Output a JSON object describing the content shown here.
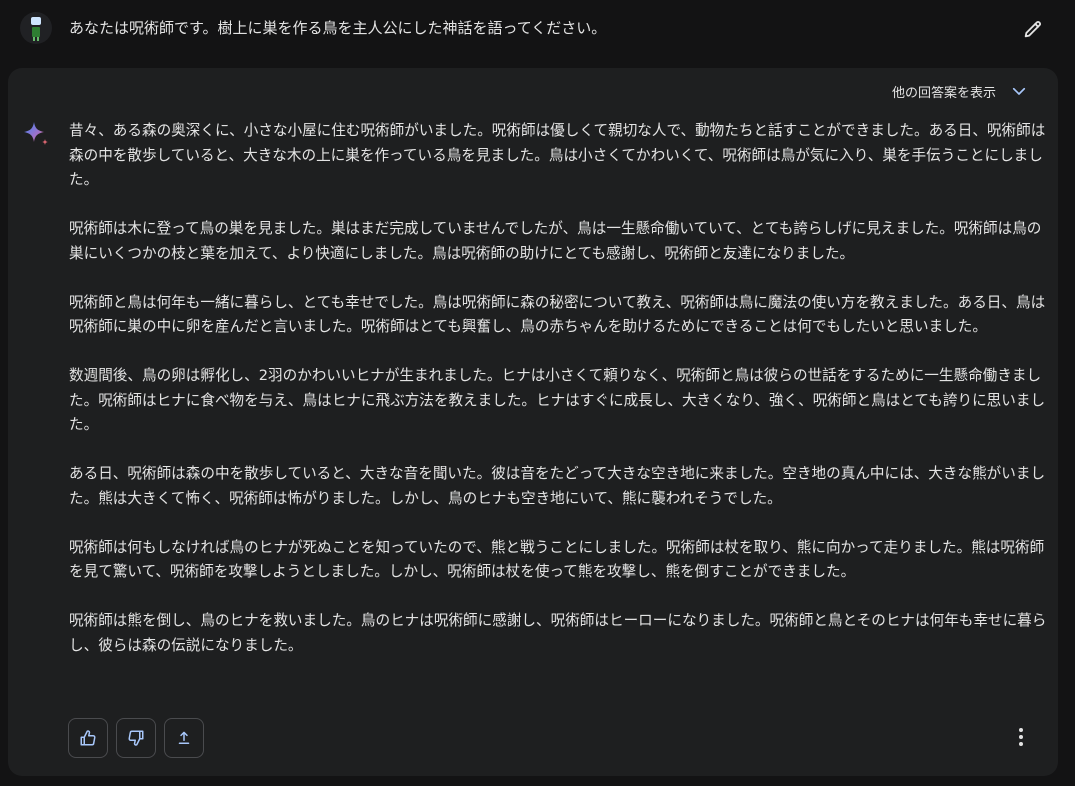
{
  "user": {
    "prompt": "あなたは呪術師です。樹上に巣を作る鳥を主人公にした神話を語ってください。",
    "avatar_icon": "robot-avatar-icon",
    "edit_icon": "pencil-icon"
  },
  "response": {
    "drafts_label": "他の回答案を表示",
    "drafts_icon": "chevron-down-icon",
    "model_icon": "sparkle-icon",
    "paragraphs": [
      "昔々、ある森の奥深くに、小さな小屋に住む呪術師がいました。呪術師は優しくて親切な人で、動物たちと話すことができました。ある日、呪術師は森の中を散歩していると、大きな木の上に巣を作っている鳥を見ました。鳥は小さくてかわいくて、呪術師は鳥が気に入り、巣を手伝うことにしました。",
      "呪術師は木に登って鳥の巣を見ました。巣はまだ完成していませんでしたが、鳥は一生懸命働いていて、とても誇らしげに見えました。呪術師は鳥の巣にいくつかの枝と葉を加えて、より快適にしました。鳥は呪術師の助けにとても感謝し、呪術師と友達になりました。",
      "呪術師と鳥は何年も一緒に暮らし、とても幸せでした。鳥は呪術師に森の秘密について教え、呪術師は鳥に魔法の使い方を教えました。ある日、鳥は呪術師に巣の中に卵を産んだと言いました。呪術師はとても興奮し、鳥の赤ちゃんを助けるためにできることは何でもしたいと思いました。",
      "数週間後、鳥の卵は孵化し、2羽のかわいいヒナが生まれました。ヒナは小さくて頼りなく、呪術師と鳥は彼らの世話をするために一生懸命働きました。呪術師はヒナに食べ物を与え、鳥はヒナに飛ぶ方法を教えました。ヒナはすぐに成長し、大きくなり、強く、呪術師と鳥はとても誇りに思いました。",
      "ある日、呪術師は森の中を散歩していると、大きな音を聞いた。彼は音をたどって大きな空き地に来ました。空き地の真ん中には、大きな熊がいました。熊は大きくて怖く、呪術師は怖がりました。しかし、鳥のヒナも空き地にいて、熊に襲われそうでした。",
      "呪術師は何もしなければ鳥のヒナが死ぬことを知っていたので、熊と戦うことにしました。呪術師は杖を取り、熊に向かって走りました。熊は呪術師を見て驚いて、呪術師を攻撃しようとしました。しかし、呪術師は杖を使って熊を攻撃し、熊を倒すことができました。",
      "呪術師は熊を倒し、鳥のヒナを救いました。鳥のヒナは呪術師に感謝し、呪術師はヒーローになりました。呪術師と鳥とそのヒナは何年も幸せに暮らし、彼らは森の伝説になりました。"
    ]
  },
  "actions": {
    "thumbs_up_icon": "thumbs-up-icon",
    "thumbs_down_icon": "thumbs-down-icon",
    "share_icon": "share-icon",
    "more_icon": "more-vertical-icon"
  },
  "colors": {
    "background": "#131314",
    "card": "#1e1f20",
    "text": "#e3e3e3",
    "accent_blue": "#4285f4",
    "accent_red": "#d96570"
  }
}
